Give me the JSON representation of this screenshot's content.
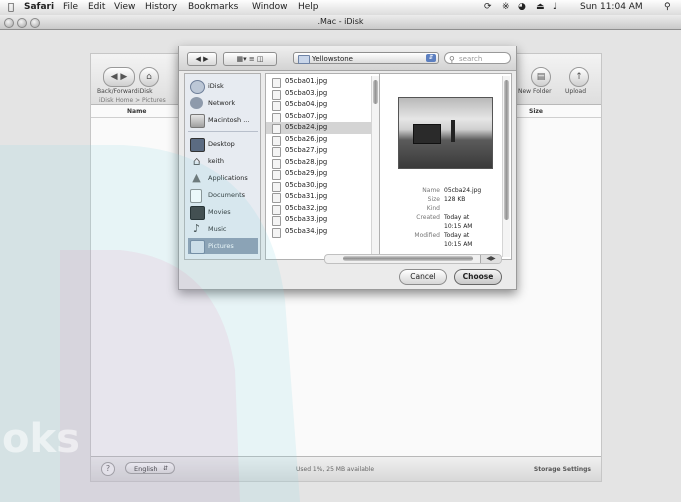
{
  "menubar": {
    "app": "Safari",
    "items": [
      "File",
      "Edit",
      "View",
      "History",
      "Bookmarks",
      "Window",
      "Help"
    ],
    "clock": "Sun 11:04 AM"
  },
  "window": {
    "title": ".Mac - iDisk"
  },
  "idisk": {
    "back_forward_label": "Back/Forward",
    "idisk_label": "iDisk",
    "path": "iDisk Home  >  Pictures",
    "new_folder_label": "New Folder",
    "upload_label": "Upload",
    "col_name": "Name",
    "col_size": "Size",
    "help": "?",
    "language": "English",
    "used": "Used 1%, 25 MB available",
    "storage_settings": "Storage Settings"
  },
  "dialog": {
    "location": "Yellowstone",
    "search_placeholder": "search",
    "sidebar": [
      {
        "label": "iDisk",
        "icon": "idisk-icon"
      },
      {
        "label": "Network",
        "icon": "network-icon"
      },
      {
        "label": "Macintosh ...",
        "icon": "harddisk-icon"
      },
      {
        "label": "Desktop",
        "icon": "desktop-icon"
      },
      {
        "label": "keith",
        "icon": "home-icon"
      },
      {
        "label": "Applications",
        "icon": "applications-icon"
      },
      {
        "label": "Documents",
        "icon": "documents-icon"
      },
      {
        "label": "Movies",
        "icon": "movies-icon"
      },
      {
        "label": "Music",
        "icon": "music-icon"
      },
      {
        "label": "Pictures",
        "icon": "pictures-icon",
        "selected": true
      }
    ],
    "files": [
      "05cba01.jpg",
      "05cba03.jpg",
      "05cba04.jpg",
      "05cba07.jpg",
      "05cba24.jpg",
      "05cba26.jpg",
      "05cba27.jpg",
      "05cba28.jpg",
      "05cba29.jpg",
      "05cba30.jpg",
      "05cba31.jpg",
      "05cba32.jpg",
      "05cba33.jpg",
      "05cba34.jpg"
    ],
    "selected_file": "05cba24.jpg",
    "preview": {
      "name_label": "Name",
      "name": "05cba24.jpg",
      "size_label": "Size",
      "size": "128 KB",
      "kind_label": "Kind",
      "kind": "",
      "created_label": "Created",
      "created_1": "Today at",
      "created_2": "10:15 AM",
      "modified_label": "Modified",
      "modified_1": "Today at",
      "modified_2": "10:15 AM"
    },
    "cancel_label": "Cancel",
    "choose_label": "Choose"
  },
  "watermark": "oks"
}
